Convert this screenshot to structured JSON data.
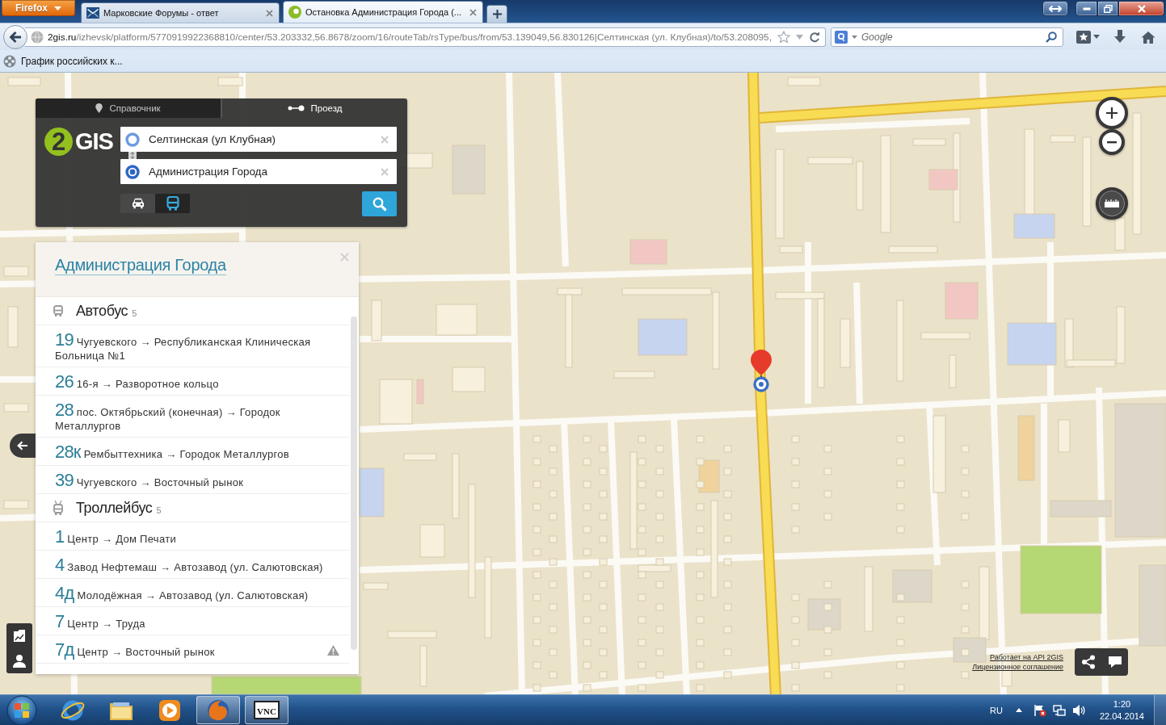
{
  "browser": {
    "menu_button": "Firefox",
    "tabs": [
      {
        "title": "Марковские Форумы - ответ",
        "kind": "forum",
        "selected": false
      },
      {
        "title": "Остановка Администрация Города (...",
        "kind": "map",
        "selected": true
      }
    ],
    "address": {
      "domain": "2gis.ru",
      "path": "/izhevsk/platform/5770919922368810/center/53.203332,56.8678/zoom/16/routeTab/rsType/bus/from/53.139049,56.830126|Селтинская (ул. Клубная)/to/53.208095,"
    },
    "search": {
      "placeholder": "Google"
    },
    "bookmarks": [
      {
        "label": "График российских к..."
      }
    ]
  },
  "search_panel": {
    "tabs": [
      {
        "label": "Справочник",
        "kind": "directory",
        "selected": false
      },
      {
        "label": "Проезд",
        "kind": "route",
        "selected": true
      }
    ],
    "logo": {
      "mark": "2",
      "text": "GIS"
    },
    "from": {
      "value": "Селтинская (ул Клубная)"
    },
    "to": {
      "value": "Администрация Города"
    },
    "modes": [
      {
        "kind": "car",
        "selected": false
      },
      {
        "kind": "bus",
        "selected": true
      }
    ]
  },
  "stop_card": {
    "title": "Администрация Города",
    "groups": [
      {
        "kind": "bus",
        "name": "Автобус",
        "count": "5",
        "routes": [
          {
            "number": "19",
            "text": "Чугуевского → Республиканская Клиническая Больница №1"
          },
          {
            "number": "26",
            "text": "16-я → Разворотное кольцо"
          },
          {
            "number": "28",
            "text": "пос. Октябрьский (конечная) → Городок Металлургов"
          },
          {
            "number": "28к",
            "text": "Рембыттехника → Городок Металлургов"
          },
          {
            "number": "39",
            "text": "Чугуевского → Восточный рынок"
          }
        ]
      },
      {
        "kind": "trolleybus",
        "name": "Троллейбус",
        "count": "5",
        "routes": [
          {
            "number": "1",
            "text": "Центр → Дом Печати"
          },
          {
            "number": "4",
            "text": "Завод Нефтемаш → Автозавод (ул. Салютовская)"
          },
          {
            "number": "4д",
            "text": "Молодёжная → Автозавод (ул. Салютовская)"
          },
          {
            "number": "7",
            "text": "Центр → Труда"
          },
          {
            "number": "7д",
            "text": "Центр → Восточный рынок"
          }
        ]
      }
    ]
  },
  "map": {
    "credits": [
      {
        "label": "Работает на API 2GIS"
      },
      {
        "label": "Лицензионное соглашение"
      }
    ]
  },
  "taskbar": {
    "apps": [
      {
        "kind": "ie",
        "running": false
      },
      {
        "kind": "explorer",
        "running": false
      },
      {
        "kind": "media",
        "running": false
      },
      {
        "kind": "firefox",
        "running": true
      },
      {
        "kind": "vnc",
        "label": "VNC",
        "running": true
      }
    ],
    "language": "RU",
    "time": "1:20",
    "date": "22.04.2014"
  }
}
